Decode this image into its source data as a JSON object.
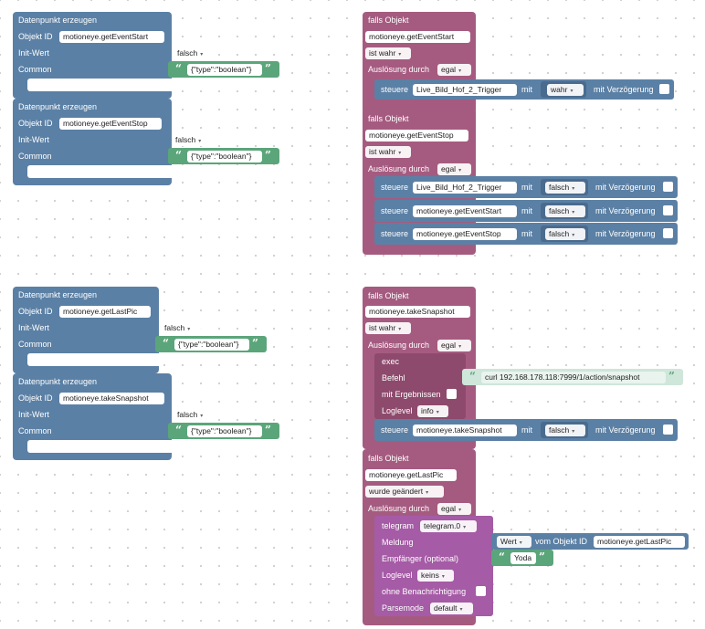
{
  "create_blocks": [
    {
      "title": "Datenpunkt erzeugen",
      "id_label": "Objekt ID",
      "id_value": "motioneye.getEventStart",
      "init_label": "Init-Wert",
      "init_value": "falsch",
      "common_label": "Common",
      "common_value": "{\"type\":\"boolean\"}"
    },
    {
      "title": "Datenpunkt erzeugen",
      "id_label": "Objekt ID",
      "id_value": "motioneye.getEventStop",
      "init_label": "Init-Wert",
      "init_value": "falsch",
      "common_label": "Common",
      "common_value": "{\"type\":\"boolean\"}"
    },
    {
      "title": "Datenpunkt erzeugen",
      "id_label": "Objekt ID",
      "id_value": "motioneye.getLastPic",
      "init_label": "Init-Wert",
      "init_value": "falsch",
      "common_label": "Common",
      "common_value": "{\"type\":\"boolean\"}"
    },
    {
      "title": "Datenpunkt erzeugen",
      "id_label": "Objekt ID",
      "id_value": "motioneye.takeSnapshot",
      "init_label": "Init-Wert",
      "init_value": "falsch",
      "common_label": "Common",
      "common_value": "{\"type\":\"boolean\"}"
    }
  ],
  "trigger_blocks": [
    {
      "title": "falls Objekt",
      "object": "motioneye.getEventStart",
      "condition": "ist wahr",
      "trigger_label": "Auslösung durch",
      "trigger_value": "egal"
    },
    {
      "title": "falls Objekt",
      "object": "motioneye.getEventStop",
      "condition": "ist wahr",
      "trigger_label": "Auslösung durch",
      "trigger_value": "egal"
    },
    {
      "title": "falls Objekt",
      "object": "motioneye.takeSnapshot",
      "condition": "ist wahr",
      "trigger_label": "Auslösung durch",
      "trigger_value": "egal"
    },
    {
      "title": "falls Objekt",
      "object": "motioneye.getLastPic",
      "condition": "wurde geändert",
      "trigger_label": "Auslösung durch",
      "trigger_value": "egal"
    }
  ],
  "control_blocks": [
    {
      "label": "steuere",
      "object": "Live_Bild_Hof_2_Trigger",
      "with": "mit",
      "value": "wahr",
      "delay_label": "mit Verzögerung"
    },
    {
      "label": "steuere",
      "object": "Live_Bild_Hof_2_Trigger",
      "with": "mit",
      "value": "falsch",
      "delay_label": "mit Verzögerung"
    },
    {
      "label": "steuere",
      "object": "motioneye.getEventStart",
      "with": "mit",
      "value": "falsch",
      "delay_label": "mit Verzögerung"
    },
    {
      "label": "steuere",
      "object": "motioneye.getEventStop",
      "with": "mit",
      "value": "falsch",
      "delay_label": "mit Verzögerung"
    },
    {
      "label": "steuere",
      "object": "motioneye.takeSnapshot",
      "with": "mit",
      "value": "falsch",
      "delay_label": "mit Verzögerung"
    }
  ],
  "exec_block": {
    "title": "exec",
    "command_label": "Befehl",
    "command_value": "curl 192.168.178.118:7999/1/action/snapshot",
    "results_label": "mit Ergebnissen",
    "loglevel_label": "Loglevel",
    "loglevel_value": "info"
  },
  "telegram_block": {
    "title": "telegram",
    "instance": "telegram.0",
    "message_label": "Meldung",
    "value_label": "Wert",
    "from_label": "vom Objekt ID",
    "from_object": "motioneye.getLastPic",
    "recipient_label": "Empfänger (optional)",
    "recipient_value": "Yoda",
    "loglevel_label": "Loglevel",
    "loglevel_value": "keins",
    "silent_label": "ohne Benachrichtigung",
    "parsemode_label": "Parsemode",
    "parsemode_value": "default"
  },
  "colors": {
    "state_blue": "#5b80a5",
    "trigger_pink": "#a55b80",
    "text_green": "#5ba57a",
    "telegram_purple": "#a55ba5"
  },
  "icons": {
    "dropdown": "▾",
    "quote_open": "“",
    "quote_close": "”"
  }
}
